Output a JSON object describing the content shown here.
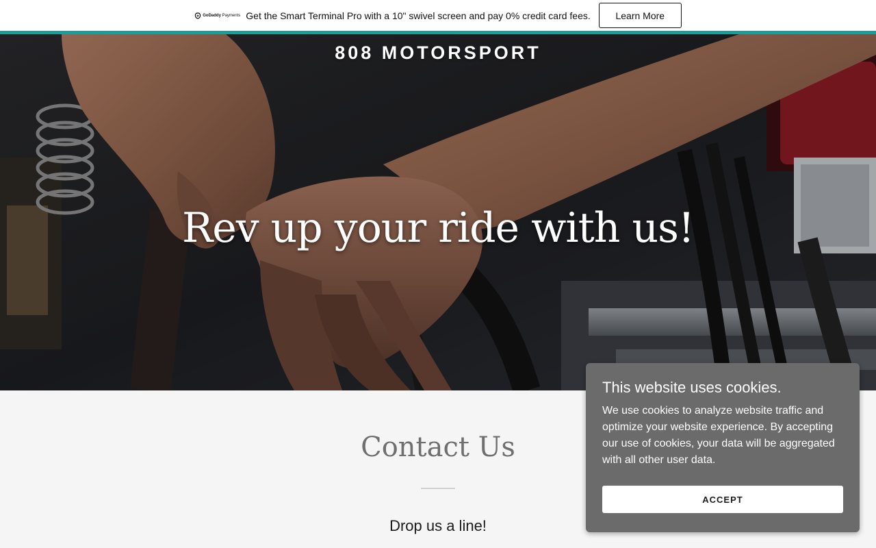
{
  "promo": {
    "logo_text_bold": "GoDaddy",
    "logo_text": "Payments",
    "message": "Get the Smart Terminal Pro with a 10\" swivel screen and pay 0% credit card fees.",
    "button_label": "Learn More",
    "accent_color": "#1b9e99"
  },
  "hero": {
    "site_title": "808 MOTORSPORT",
    "headline": "Rev up your ride with us!",
    "background_image": "mechanic-hands-engine-bay"
  },
  "contact": {
    "title": "Contact Us",
    "subtitle": "Drop us a line!"
  },
  "cookie_banner": {
    "title": "This website uses cookies.",
    "body": "We use cookies to analyze website traffic and optimize your website experience. By accepting our use of cookies, your data will be aggregated with all other user data.",
    "accept_label": "ACCEPT",
    "background_color": "#6b6b6b"
  }
}
